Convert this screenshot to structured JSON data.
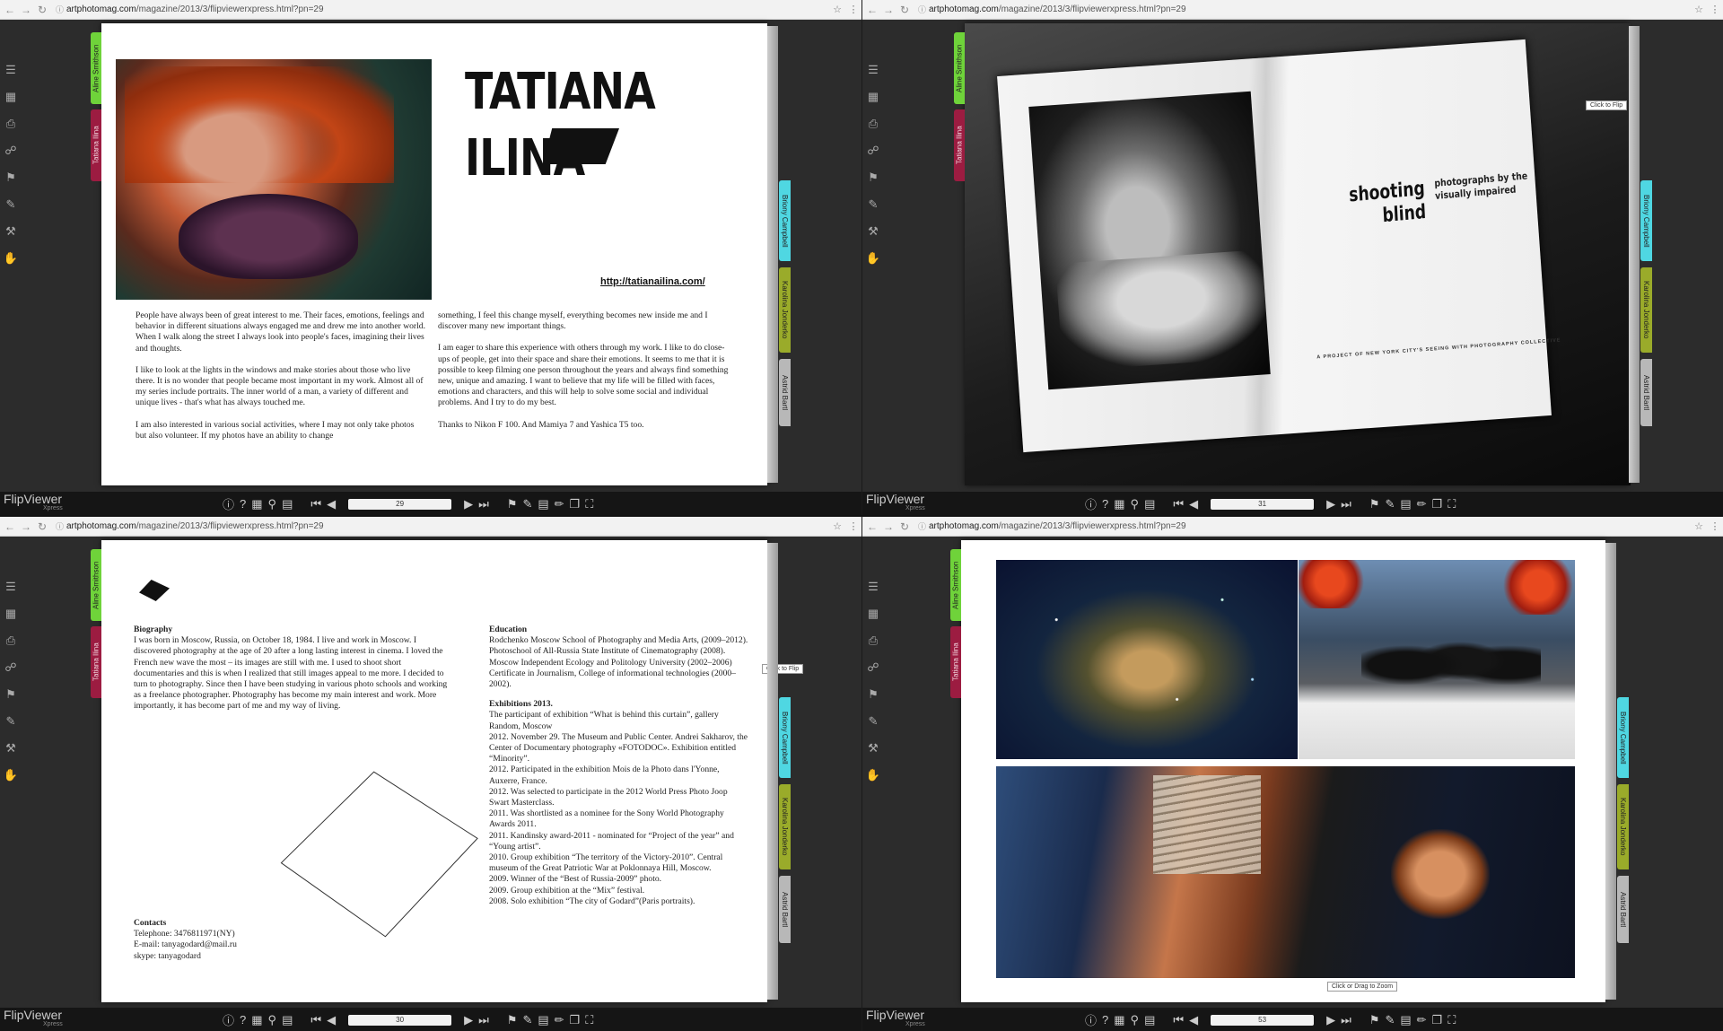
{
  "browser": {
    "url_host": "artphotomag.com",
    "url_path": "/magazine/2013/3/flipviewerxpress.html?pn=29"
  },
  "tabs": {
    "left": [
      "Aline Smithson",
      "Tatiana Ilina"
    ],
    "right": [
      "Briony Campbell",
      "Karolina Jonderko",
      "Astrid Bartl"
    ]
  },
  "viewer": {
    "logo": "FlipViewer",
    "logo_sub": "Xpress",
    "hint_flip": "Click to Flip",
    "hint_zoom": "Click or Drag to Zoom",
    "icons": [
      "list-icon",
      "thumbnails-icon",
      "print-icon",
      "share-icon",
      "bookmark-icon",
      "note-icon",
      "tools-icon",
      "hand-icon"
    ]
  },
  "q1": {
    "page_num": "29",
    "name_line1": "TATIANA",
    "name_line2": "ILINA",
    "website": "http://tatianailina.com/",
    "col1": [
      "People have always been of great interest to me. Their faces, emotions, feelings and behavior in different situations always engaged me and drew me into another world. When I walk along the street I always look into people's faces, imagining their lives and thoughts.",
      "I like to look at the lights in the windows and make stories about those who live there. It is no wonder that people became most important in my work. Almost all of my series include portraits. The inner world of a man, a variety of different and unique lives - that's what has always touched me.",
      "I am also interested in various social activities, where I may not only take photos but also volunteer. If my photos have an ability to change"
    ],
    "col2": [
      "something, I feel this change myself, everything becomes new inside me and I discover many new important things.",
      "I am eager to share this experience with others through my work. I like to do close-ups of people, get into their space and share their emotions. It seems to me that it is possible to keep filming one person throughout the years and always find something new, unique and amazing. I want to believe that my life will be filled with faces, emotions and characters, and this will help to solve some social and individual problems. And I try to do my best.",
      "Thanks to Nikon F 100. And Mamiya 7 and Yashica T5 too."
    ]
  },
  "q2": {
    "page_num": "31",
    "book_title": "shooting blind",
    "book_subtitle": "photographs by the visually impaired",
    "book_project": "A PROJECT OF NEW YORK CITY'S SEEING WITH PHOTOGRAPHY COLLECTIVE"
  },
  "q3": {
    "page_num": "30",
    "bio_heading": "Biography",
    "bio": "I was born in Moscow, Russia, on October 18, 1984. I live and work in Moscow. I discovered photography at the age of 20 after a long lasting interest in cinema. I loved the French new wave the most – its images are still with me. I used to shoot short documentaries and this is when I realized that still images appeal to me more. I decided to turn to photography. Since then I have been studying in various photo schools and working as a freelance photographer. Photography has become my main interest and work. More importantly, it has become part of me and my way of living.",
    "contacts_heading": "Contacts",
    "contacts": [
      "Telephone: 3476811971(NY)",
      "E-mail: tanyagodard@mail.ru",
      "skype: tanyagodard"
    ],
    "edu_heading": "Education",
    "education": [
      "Rodchenko Moscow School of Photography and Media Arts, (2009–2012).",
      "Photoschool of All-Russia State Institute of Cinematography (2008).",
      "Moscow Independent Ecology and Politology University (2002–2006)",
      "Certificate in Journalism, College of informational technologies (2000–2002)."
    ],
    "exh_heading": "Exhibitions 2013.",
    "exhibitions": [
      "The participant of exhibition “What is behind this curtain”, gallery Random, Moscow",
      "2012. November 29. The Museum and Public Center. Andrei Sakharov, the Center of Documentary photography «FOTODOC». Exhibition entitled “Minority”.",
      "2012. Participated in the exhibition Mois de la Photo dans l'Yonne, Auxerre, France.",
      "2012. Was selected to participate in the 2012 World Press Photo Joop Swart Masterclass.",
      "2011. Was shortlisted as a nominee for the Sony World Photography Awards 2011.",
      "2011. Kandinsky award-2011 - nominated for “Project of the year” and “Young artist”.",
      "2010. Group exhibition “The territory of the Victory-2010”. Central museum of the Great Patriotic War at Poklonnaya Hill, Moscow.",
      "2009. Winner of the “Best of Russia-2009” photo.",
      "2009. Group exhibition at the “Mix” festival.",
      "2008. Solo exhibition “The city of Godard”(Paris portraits)."
    ]
  },
  "q4": {
    "page_num": "53"
  }
}
